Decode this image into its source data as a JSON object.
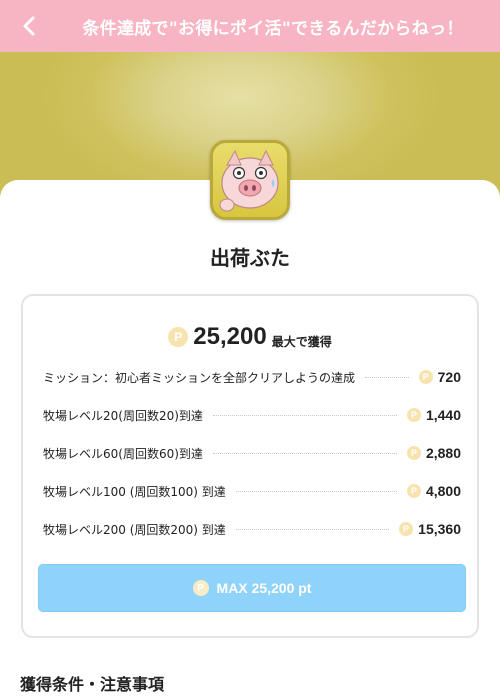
{
  "header": {
    "title": "条件達成で\"お得にポイ活\"できるんだからねっ！",
    "back_icon": "chevron-left-icon",
    "background": "#f7b4c2"
  },
  "app": {
    "name": "出荷ぶた",
    "icon": "pig-app-icon"
  },
  "rewards": {
    "coin_symbol": "P",
    "total": "25,200",
    "total_suffix": "最大で獲得",
    "missions": [
      {
        "label": "ミッション：初心者ミッションを全部クリアしようの達成",
        "points": "720"
      },
      {
        "label": "牧場レベル20(周回数20)到達",
        "points": "1,440"
      },
      {
        "label": "牧場レベル60(周回数60)到達",
        "points": "2,880"
      },
      {
        "label": "牧場レベル100 (周回数100) 到達",
        "points": "4,800"
      },
      {
        "label": "牧場レベル200 (周回数200) 到達",
        "points": "15,360"
      }
    ],
    "max_button_label": "MAX 25,200 pt",
    "button_color": "#8fd3fb"
  },
  "conditions": {
    "title": "獲得条件・注意事項"
  }
}
